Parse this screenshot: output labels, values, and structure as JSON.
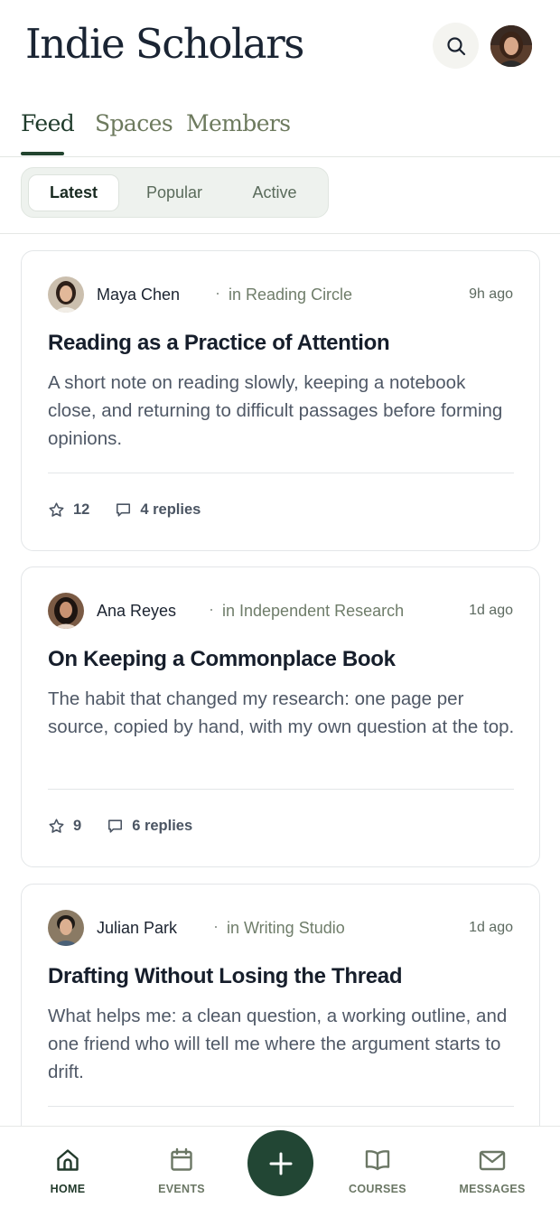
{
  "app": {
    "title": "Indie Scholars"
  },
  "header": {
    "search_icon": "search-icon",
    "avatar": "user-avatar"
  },
  "tabs": [
    {
      "label": "Feed",
      "active": true
    },
    {
      "label": "Spaces",
      "active": false
    },
    {
      "label": "Members",
      "active": false
    }
  ],
  "filters": [
    {
      "label": "Latest",
      "active": true
    },
    {
      "label": "Popular",
      "active": false
    },
    {
      "label": "Active",
      "active": false
    }
  ],
  "posts": [
    {
      "author": "Maya Chen",
      "separator": "·",
      "space": "in Reading Circle",
      "time": "9h ago",
      "title": "Reading as a Practice of Attention",
      "body": "A short note on reading slowly, keeping a notebook close, and returning to difficult passages before forming opinions.",
      "stars": "12",
      "replies": "4 replies"
    },
    {
      "author": "Ana Reyes",
      "separator": "·",
      "space": "in Independent Research",
      "time": "1d ago",
      "title": "On Keeping a Commonplace Book",
      "body": "The habit that changed my research: one page per source, copied by hand, with my own question at the top.",
      "stars": "9",
      "replies": "6 replies"
    },
    {
      "author": "Julian Park",
      "separator": "·",
      "space": "in Writing Studio",
      "time": "1d ago",
      "title": "Drafting Without Losing the Thread",
      "body": "What helps me: a clean question, a working outline, and one friend who will tell me where the argument starts to drift.",
      "stars": "",
      "replies": ""
    }
  ],
  "nav": {
    "home": "HOME",
    "events": "EVENTS",
    "courses": "COURSES",
    "messages": "MESSAGES",
    "fab_icon": "plus-icon"
  },
  "colors": {
    "accent": "#224634",
    "tab_active": "#1f3b2b",
    "muted_green": "#6d7a5e",
    "card_border": "#e3e6e8"
  }
}
